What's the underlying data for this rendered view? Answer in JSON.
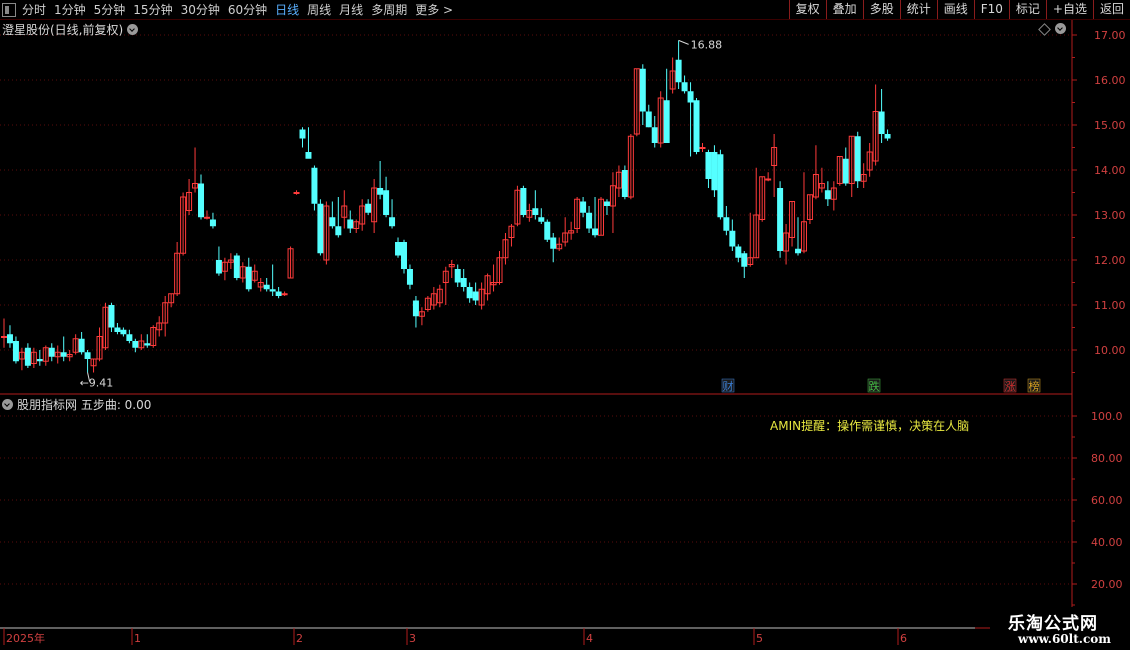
{
  "toolbar": {
    "periods": [
      "分时",
      "1分钟",
      "5分钟",
      "15分钟",
      "30分钟",
      "60分钟",
      "日线",
      "周线",
      "月线",
      "多周期",
      "更多 >"
    ],
    "active_period": "日线",
    "buttons": [
      "复权",
      "叠加",
      "多股",
      "统计",
      "画线",
      "F10",
      "标记",
      "+自选",
      "返回"
    ]
  },
  "main_panel": {
    "title": "澄星股份(日线,前复权)",
    "high_label": "16.88",
    "low_label": "9.41",
    "event_marks": [
      {
        "text": "财",
        "color": "#3a7fd8"
      },
      {
        "text": "跌",
        "color": "#44bb44"
      },
      {
        "text": "涨",
        "color": "#d83030"
      },
      {
        "text": "榜",
        "color": "#d8a020"
      }
    ]
  },
  "sub_panel": {
    "title": "股朋指标网 五步曲: 0.00",
    "reminder": "AMIN提醒：操作需谨慎，决策在人脑"
  },
  "time_axis": {
    "labels": [
      "2025年",
      "1",
      "2",
      "3",
      "4",
      "5",
      "6"
    ]
  },
  "watermark": {
    "line1": "乐淘公式网",
    "line2": "www.60lt.com"
  },
  "chart_data": [
    {
      "type": "candlestick",
      "title": "澄星股份(日线,前复权)",
      "y_ticks": [
        "17.00",
        "16.00",
        "15.00",
        "14.00",
        "13.00",
        "12.00",
        "11.00",
        "10.00"
      ],
      "ylim": [
        9.1,
        17.4
      ],
      "up_color": "#ff3b3b",
      "down_color": "#54ffff",
      "candles": [
        {
          "o": 10.3,
          "h": 10.7,
          "l": 10.05,
          "c": 10.3
        },
        {
          "o": 10.35,
          "h": 10.55,
          "l": 10.05,
          "c": 10.15
        },
        {
          "o": 10.2,
          "h": 10.3,
          "l": 9.7,
          "c": 9.75
        },
        {
          "o": 9.8,
          "h": 10.05,
          "l": 9.55,
          "c": 9.95
        },
        {
          "o": 10.05,
          "h": 10.15,
          "l": 9.6,
          "c": 9.65
        },
        {
          "o": 9.7,
          "h": 10.05,
          "l": 9.6,
          "c": 9.95
        },
        {
          "o": 9.8,
          "h": 10.0,
          "l": 9.65,
          "c": 9.75
        },
        {
          "o": 9.75,
          "h": 10.1,
          "l": 9.65,
          "c": 10.05
        },
        {
          "o": 10.05,
          "h": 10.15,
          "l": 9.75,
          "c": 9.85
        },
        {
          "o": 9.85,
          "h": 10.1,
          "l": 9.7,
          "c": 9.95
        },
        {
          "o": 9.95,
          "h": 10.3,
          "l": 9.75,
          "c": 9.85
        },
        {
          "o": 9.85,
          "h": 10.0,
          "l": 9.75,
          "c": 9.9
        },
        {
          "o": 9.95,
          "h": 10.35,
          "l": 9.9,
          "c": 10.25
        },
        {
          "o": 10.25,
          "h": 10.4,
          "l": 9.9,
          "c": 9.95
        },
        {
          "o": 9.95,
          "h": 10.0,
          "l": 9.5,
          "c": 9.8
        },
        {
          "o": 9.65,
          "h": 9.8,
          "l": 9.5,
          "c": 9.8
        },
        {
          "o": 9.8,
          "h": 10.5,
          "l": 9.75,
          "c": 10.3
        },
        {
          "o": 10.05,
          "h": 11.05,
          "l": 10.0,
          "c": 10.95
        },
        {
          "o": 11.0,
          "h": 11.05,
          "l": 10.4,
          "c": 10.5
        },
        {
          "o": 10.5,
          "h": 10.6,
          "l": 10.35,
          "c": 10.4
        },
        {
          "o": 10.45,
          "h": 10.5,
          "l": 10.3,
          "c": 10.35
        },
        {
          "o": 10.35,
          "h": 10.45,
          "l": 10.15,
          "c": 10.2
        },
        {
          "o": 10.2,
          "h": 10.25,
          "l": 9.95,
          "c": 10.05
        },
        {
          "o": 10.05,
          "h": 10.35,
          "l": 10.0,
          "c": 10.2
        },
        {
          "o": 10.15,
          "h": 10.35,
          "l": 10.05,
          "c": 10.1
        },
        {
          "o": 10.1,
          "h": 10.55,
          "l": 10.05,
          "c": 10.5
        },
        {
          "o": 10.45,
          "h": 10.75,
          "l": 10.3,
          "c": 10.6
        },
        {
          "o": 10.6,
          "h": 11.2,
          "l": 10.3,
          "c": 11.05
        },
        {
          "o": 11.05,
          "h": 11.25,
          "l": 10.95,
          "c": 11.25
        },
        {
          "o": 11.25,
          "h": 12.4,
          "l": 11.2,
          "c": 12.15
        },
        {
          "o": 12.15,
          "h": 13.5,
          "l": 12.1,
          "c": 13.4
        },
        {
          "o": 13.1,
          "h": 13.8,
          "l": 13.0,
          "c": 13.5
        },
        {
          "o": 13.6,
          "h": 14.5,
          "l": 13.5,
          "c": 13.7
        },
        {
          "o": 13.7,
          "h": 13.9,
          "l": 12.9,
          "c": 12.95
        },
        {
          "o": 12.95,
          "h": 13.1,
          "l": 12.9,
          "c": 12.95
        },
        {
          "o": 12.9,
          "h": 13.05,
          "l": 12.7,
          "c": 12.75
        },
        {
          "o": 12.0,
          "h": 12.3,
          "l": 11.65,
          "c": 11.7
        },
        {
          "o": 11.75,
          "h": 12.05,
          "l": 11.55,
          "c": 11.95
        },
        {
          "o": 11.95,
          "h": 12.15,
          "l": 11.8,
          "c": 12.0
        },
        {
          "o": 12.1,
          "h": 12.15,
          "l": 11.55,
          "c": 11.6
        },
        {
          "o": 11.6,
          "h": 11.95,
          "l": 11.5,
          "c": 11.85
        },
        {
          "o": 11.85,
          "h": 12.05,
          "l": 11.3,
          "c": 11.35
        },
        {
          "o": 11.55,
          "h": 11.9,
          "l": 11.5,
          "c": 11.75
        },
        {
          "o": 11.4,
          "h": 11.6,
          "l": 11.3,
          "c": 11.5
        },
        {
          "o": 11.45,
          "h": 11.6,
          "l": 11.3,
          "c": 11.35
        },
        {
          "o": 11.35,
          "h": 11.9,
          "l": 11.2,
          "c": 11.3
        },
        {
          "o": 11.3,
          "h": 11.4,
          "l": 11.15,
          "c": 11.2
        },
        {
          "o": 11.25,
          "h": 11.3,
          "l": 11.2,
          "c": 11.25
        },
        {
          "o": 11.6,
          "h": 12.3,
          "l": 11.6,
          "c": 12.25
        },
        {
          "o": 13.5,
          "h": 13.55,
          "l": 13.45,
          "c": 13.5
        },
        {
          "o": 14.9,
          "h": 14.95,
          "l": 14.5,
          "c": 14.7
        },
        {
          "o": 14.4,
          "h": 14.95,
          "l": 14.3,
          "c": 14.25
        },
        {
          "o": 14.05,
          "h": 14.1,
          "l": 13.1,
          "c": 13.25
        },
        {
          "o": 13.25,
          "h": 13.35,
          "l": 12.1,
          "c": 12.15
        },
        {
          "o": 12.0,
          "h": 13.3,
          "l": 11.9,
          "c": 13.2
        },
        {
          "o": 12.95,
          "h": 13.3,
          "l": 12.7,
          "c": 12.75
        },
        {
          "o": 12.75,
          "h": 13.4,
          "l": 12.5,
          "c": 12.55
        },
        {
          "o": 12.95,
          "h": 13.55,
          "l": 12.7,
          "c": 13.2
        },
        {
          "o": 12.9,
          "h": 13.1,
          "l": 12.6,
          "c": 12.7
        },
        {
          "o": 12.7,
          "h": 12.9,
          "l": 12.6,
          "c": 12.85
        },
        {
          "o": 12.8,
          "h": 13.35,
          "l": 12.65,
          "c": 13.2
        },
        {
          "o": 13.25,
          "h": 13.35,
          "l": 13.0,
          "c": 13.05
        },
        {
          "o": 12.85,
          "h": 13.8,
          "l": 12.6,
          "c": 13.6
        },
        {
          "o": 13.6,
          "h": 14.2,
          "l": 13.35,
          "c": 13.45
        },
        {
          "o": 13.55,
          "h": 13.85,
          "l": 12.95,
          "c": 13.0
        },
        {
          "o": 12.95,
          "h": 13.35,
          "l": 12.7,
          "c": 12.75
        },
        {
          "o": 12.4,
          "h": 12.5,
          "l": 12.05,
          "c": 12.1
        },
        {
          "o": 12.4,
          "h": 12.45,
          "l": 11.7,
          "c": 11.8
        },
        {
          "o": 11.8,
          "h": 11.9,
          "l": 11.35,
          "c": 11.45
        },
        {
          "o": 11.1,
          "h": 11.2,
          "l": 10.5,
          "c": 10.75
        },
        {
          "o": 10.75,
          "h": 10.95,
          "l": 10.55,
          "c": 10.85
        },
        {
          "o": 10.9,
          "h": 11.2,
          "l": 10.85,
          "c": 11.15
        },
        {
          "o": 11.0,
          "h": 11.4,
          "l": 10.9,
          "c": 11.25
        },
        {
          "o": 11.05,
          "h": 11.45,
          "l": 10.95,
          "c": 11.35
        },
        {
          "o": 11.5,
          "h": 11.85,
          "l": 11.0,
          "c": 11.75
        },
        {
          "o": 11.85,
          "h": 12.0,
          "l": 11.6,
          "c": 11.9
        },
        {
          "o": 11.8,
          "h": 11.9,
          "l": 11.4,
          "c": 11.5
        },
        {
          "o": 11.6,
          "h": 11.8,
          "l": 11.3,
          "c": 11.4
        },
        {
          "o": 11.4,
          "h": 11.5,
          "l": 11.05,
          "c": 11.15
        },
        {
          "o": 11.3,
          "h": 11.5,
          "l": 11.0,
          "c": 11.1
        },
        {
          "o": 11.0,
          "h": 11.5,
          "l": 10.9,
          "c": 11.35
        },
        {
          "o": 11.25,
          "h": 11.7,
          "l": 11.1,
          "c": 11.65
        },
        {
          "o": 11.45,
          "h": 11.9,
          "l": 11.3,
          "c": 11.5
        },
        {
          "o": 11.5,
          "h": 12.2,
          "l": 11.45,
          "c": 12.05
        },
        {
          "o": 12.05,
          "h": 12.6,
          "l": 11.9,
          "c": 12.45
        },
        {
          "o": 12.5,
          "h": 12.8,
          "l": 12.3,
          "c": 12.75
        },
        {
          "o": 12.8,
          "h": 13.65,
          "l": 12.75,
          "c": 13.55
        },
        {
          "o": 13.6,
          "h": 13.65,
          "l": 12.95,
          "c": 13.0
        },
        {
          "o": 12.95,
          "h": 13.25,
          "l": 12.85,
          "c": 13.1
        },
        {
          "o": 13.15,
          "h": 13.55,
          "l": 12.9,
          "c": 13.0
        },
        {
          "o": 12.95,
          "h": 13.15,
          "l": 12.8,
          "c": 12.85
        },
        {
          "o": 12.85,
          "h": 12.9,
          "l": 12.4,
          "c": 12.45
        },
        {
          "o": 12.5,
          "h": 12.6,
          "l": 11.95,
          "c": 12.25
        },
        {
          "o": 12.25,
          "h": 12.5,
          "l": 12.2,
          "c": 12.35
        },
        {
          "o": 12.4,
          "h": 12.95,
          "l": 12.3,
          "c": 12.6
        },
        {
          "o": 12.6,
          "h": 12.85,
          "l": 12.45,
          "c": 12.65
        },
        {
          "o": 12.7,
          "h": 13.4,
          "l": 12.6,
          "c": 13.35
        },
        {
          "o": 13.3,
          "h": 13.4,
          "l": 12.95,
          "c": 13.05
        },
        {
          "o": 13.05,
          "h": 13.2,
          "l": 12.6,
          "c": 12.7
        },
        {
          "o": 12.7,
          "h": 13.4,
          "l": 12.5,
          "c": 12.55
        },
        {
          "o": 12.55,
          "h": 13.4,
          "l": 12.55,
          "c": 13.35
        },
        {
          "o": 13.3,
          "h": 13.35,
          "l": 13.0,
          "c": 13.2
        },
        {
          "o": 13.2,
          "h": 13.95,
          "l": 12.6,
          "c": 13.65
        },
        {
          "o": 13.6,
          "h": 14.1,
          "l": 13.4,
          "c": 13.95
        },
        {
          "o": 14.0,
          "h": 14.1,
          "l": 13.35,
          "c": 13.4
        },
        {
          "o": 13.4,
          "h": 14.8,
          "l": 13.35,
          "c": 14.75
        },
        {
          "o": 14.8,
          "h": 16.25,
          "l": 14.75,
          "c": 16.25
        },
        {
          "o": 16.25,
          "h": 16.35,
          "l": 15.0,
          "c": 15.3
        },
        {
          "o": 15.3,
          "h": 15.45,
          "l": 14.95,
          "c": 14.95
        },
        {
          "o": 14.95,
          "h": 15.2,
          "l": 14.5,
          "c": 14.6
        },
        {
          "o": 14.6,
          "h": 15.75,
          "l": 14.5,
          "c": 15.6
        },
        {
          "o": 15.55,
          "h": 16.25,
          "l": 14.65,
          "c": 14.6
        },
        {
          "o": 15.8,
          "h": 16.5,
          "l": 15.7,
          "c": 16.2
        },
        {
          "o": 16.45,
          "h": 16.88,
          "l": 15.8,
          "c": 15.95
        },
        {
          "o": 15.95,
          "h": 16.1,
          "l": 15.7,
          "c": 15.75
        },
        {
          "o": 15.75,
          "h": 15.95,
          "l": 14.3,
          "c": 15.5
        },
        {
          "o": 15.55,
          "h": 15.6,
          "l": 14.35,
          "c": 14.4
        },
        {
          "o": 14.5,
          "h": 14.6,
          "l": 14.4,
          "c": 14.5
        },
        {
          "o": 14.4,
          "h": 14.45,
          "l": 13.6,
          "c": 13.8
        },
        {
          "o": 14.4,
          "h": 14.55,
          "l": 13.4,
          "c": 13.55
        },
        {
          "o": 14.35,
          "h": 14.45,
          "l": 12.9,
          "c": 12.95
        },
        {
          "o": 12.95,
          "h": 13.2,
          "l": 12.55,
          "c": 12.65
        },
        {
          "o": 12.65,
          "h": 12.9,
          "l": 12.2,
          "c": 12.3
        },
        {
          "o": 12.3,
          "h": 12.35,
          "l": 11.95,
          "c": 12.05
        },
        {
          "o": 12.15,
          "h": 12.2,
          "l": 11.6,
          "c": 11.85
        },
        {
          "o": 11.9,
          "h": 13.05,
          "l": 11.85,
          "c": 12.05
        },
        {
          "o": 12.05,
          "h": 14.05,
          "l": 12.05,
          "c": 13.0
        },
        {
          "o": 12.9,
          "h": 13.85,
          "l": 12.85,
          "c": 13.85
        },
        {
          "o": 13.8,
          "h": 13.95,
          "l": 13.75,
          "c": 13.8
        },
        {
          "o": 14.1,
          "h": 14.8,
          "l": 13.4,
          "c": 14.5
        },
        {
          "o": 13.6,
          "h": 13.75,
          "l": 12.05,
          "c": 12.2
        },
        {
          "o": 12.2,
          "h": 12.8,
          "l": 11.9,
          "c": 12.6
        },
        {
          "o": 12.5,
          "h": 13.3,
          "l": 12.3,
          "c": 13.3
        },
        {
          "o": 12.25,
          "h": 12.95,
          "l": 12.1,
          "c": 12.15
        },
        {
          "o": 12.2,
          "h": 13.95,
          "l": 12.15,
          "c": 12.85
        },
        {
          "o": 12.9,
          "h": 13.45,
          "l": 12.8,
          "c": 13.45
        },
        {
          "o": 13.4,
          "h": 14.55,
          "l": 13.35,
          "c": 13.9
        },
        {
          "o": 13.6,
          "h": 14.05,
          "l": 13.5,
          "c": 13.7
        },
        {
          "o": 13.55,
          "h": 13.75,
          "l": 13.2,
          "c": 13.35
        },
        {
          "o": 13.35,
          "h": 13.75,
          "l": 13.1,
          "c": 13.6
        },
        {
          "o": 13.7,
          "h": 14.3,
          "l": 13.65,
          "c": 14.3
        },
        {
          "o": 14.25,
          "h": 14.5,
          "l": 13.65,
          "c": 13.7
        },
        {
          "o": 13.7,
          "h": 14.75,
          "l": 13.4,
          "c": 14.75
        },
        {
          "o": 14.75,
          "h": 14.85,
          "l": 13.6,
          "c": 13.75
        },
        {
          "o": 13.75,
          "h": 14.15,
          "l": 13.6,
          "c": 13.9
        },
        {
          "o": 14.0,
          "h": 14.6,
          "l": 13.85,
          "c": 14.4
        },
        {
          "o": 14.2,
          "h": 15.9,
          "l": 14.1,
          "c": 15.3
        },
        {
          "o": 15.3,
          "h": 15.8,
          "l": 14.6,
          "c": 14.8
        },
        {
          "o": 14.8,
          "h": 14.9,
          "l": 14.65,
          "c": 14.7
        }
      ]
    },
    {
      "type": "line",
      "title": "股朋指标网 五步曲: 0.00",
      "series": [
        {
          "name": "五步曲",
          "values": [
            0.0
          ]
        }
      ],
      "y_ticks": [
        "100.0",
        "80.00",
        "60.00",
        "40.00",
        "20.00"
      ],
      "ylim": [
        0,
        110
      ]
    }
  ]
}
